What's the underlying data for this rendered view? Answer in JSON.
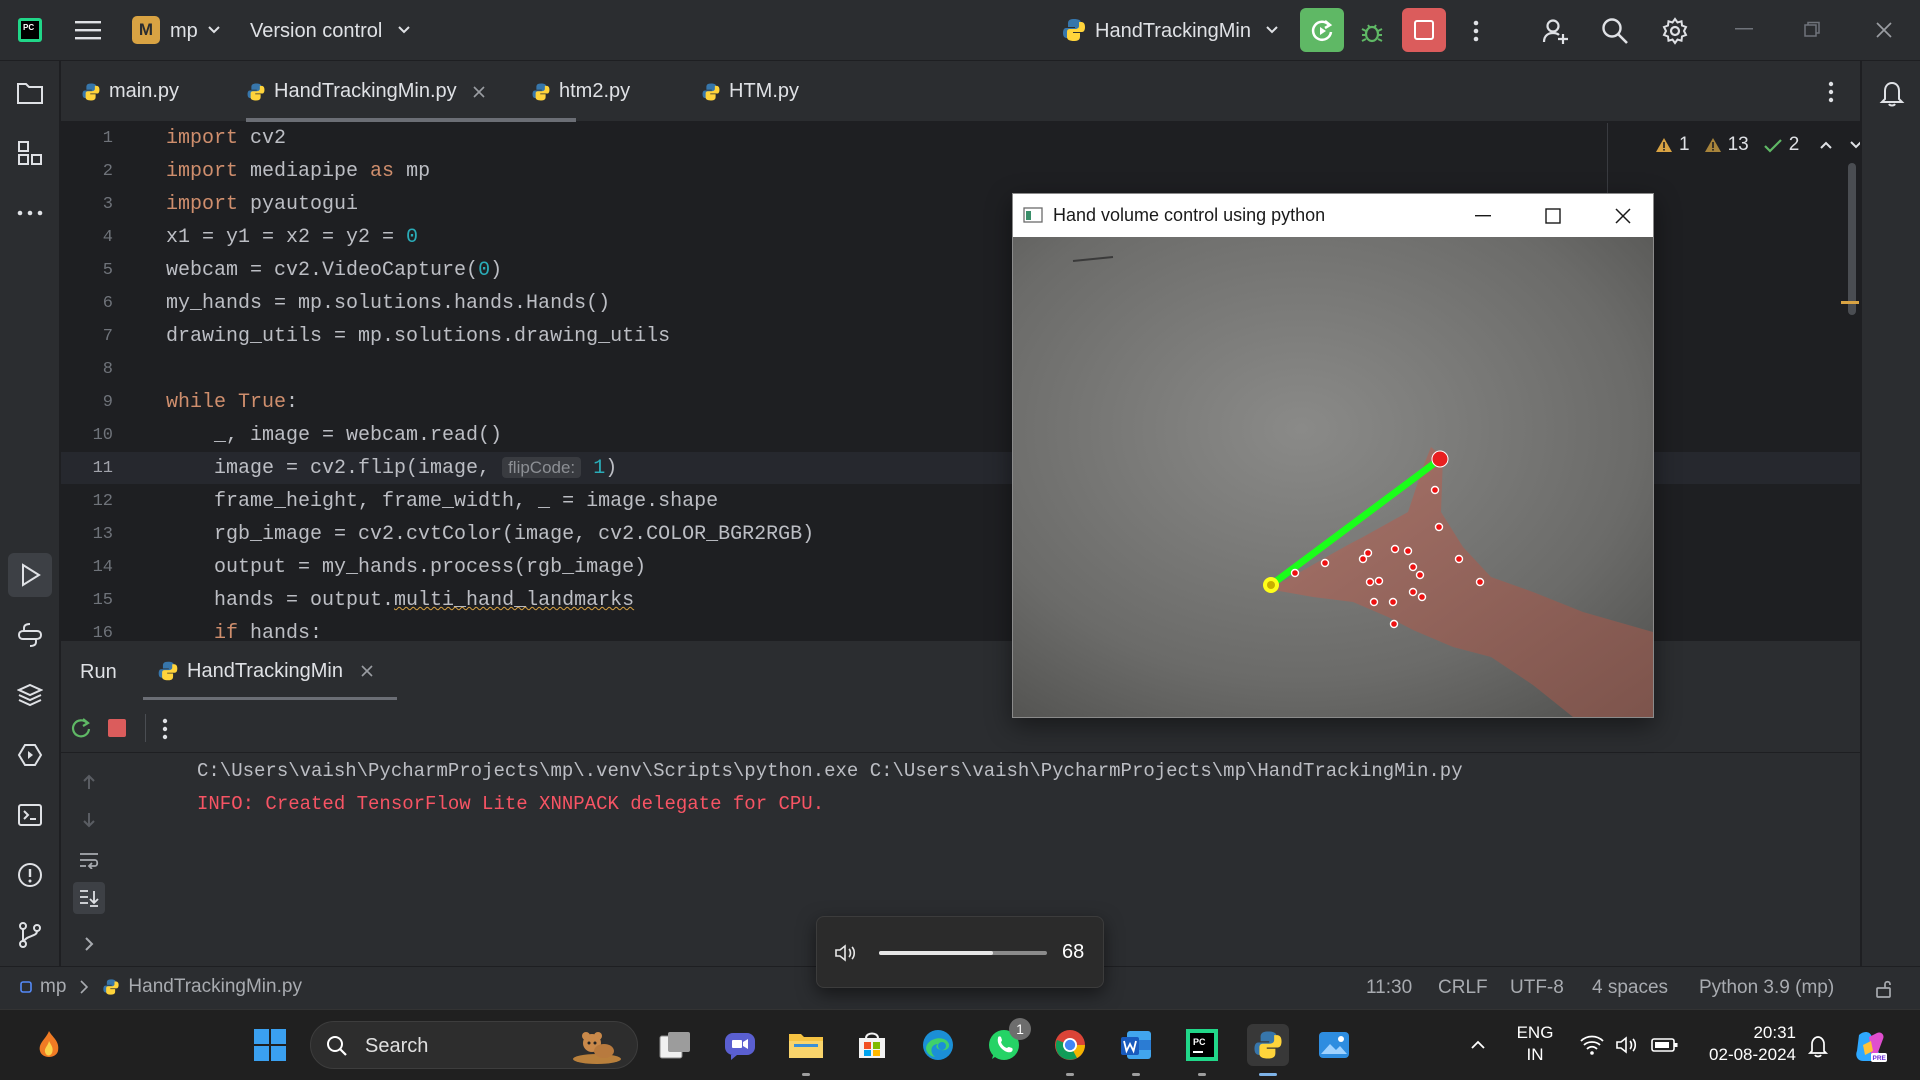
{
  "titlebar": {
    "project_badge": "M",
    "project_name": "mp",
    "vcs_label": "Version control",
    "run_config": "HandTrackingMin"
  },
  "tabs": [
    {
      "label": "main.py"
    },
    {
      "label": "HandTrackingMin.py"
    },
    {
      "label": "htm2.py"
    },
    {
      "label": "HTM.py"
    }
  ],
  "inspections": {
    "errors": "1",
    "warnings": "13",
    "ok": "2"
  },
  "code": {
    "line_numbers": [
      "1",
      "2",
      "3",
      "4",
      "5",
      "6",
      "7",
      "8",
      "9",
      "10",
      "11",
      "12",
      "13",
      "14",
      "15",
      "16"
    ],
    "l1_kw": "import",
    "l1_rest": " cv2",
    "l2_kw": "import",
    "l2_mid": " mediapipe ",
    "l2_kw2": "as",
    "l2_rest": " mp",
    "l3_kw": "import",
    "l3_rest": " pyautogui",
    "l4_rest": "x1 = y1 = x2 = y2 = ",
    "l4_num": "0",
    "l5_rest": "webcam = cv2.VideoCapture(",
    "l5_num": "0",
    "l5_end": ")",
    "l6": "my_hands = mp.solutions.hands.Hands()",
    "l7": "drawing_utils = mp.solutions.drawing_utils",
    "l9_kw": "while",
    "l9_kw2": " True",
    "l9_end": ":",
    "l10": "    _, image = webcam.read()",
    "l11_a": "    image = cv2.flip(image, ",
    "l11_hint": "flipCode:",
    "l11_num": "1",
    "l11_end": ")",
    "l12": "    frame_height, frame_width, _ = image.shape",
    "l13": "    rgb_image = cv2.cvtColor(image, cv2.COLOR_BGR2RGB)",
    "l14": "    output = my_hands.process(rgb_image)",
    "l15_a": "    hands = output.",
    "l15_b": "multi_hand_landmarks",
    "l16_kw": "    if",
    "l16_rest": " hands:"
  },
  "run": {
    "tab_run": "Run",
    "tab_config": "HandTrackingMin",
    "console_line1": "C:\\Users\\vaish\\PycharmProjects\\mp\\.venv\\Scripts\\python.exe C:\\Users\\vaish\\PycharmProjects\\mp\\HandTrackingMin.py",
    "console_line2": "INFO: Created TensorFlow Lite XNNPACK delegate for CPU."
  },
  "statusbar": {
    "breadcrumb_project": "mp",
    "breadcrumb_file": "HandTrackingMin.py",
    "position": "11:30",
    "line_sep": "CRLF",
    "encoding": "UTF-8",
    "indent": "4 spaces",
    "interpreter": "Python 3.9 (mp)"
  },
  "cv_window": {
    "title": "Hand volume control using python"
  },
  "volume": {
    "level": 68
  },
  "taskbar": {
    "search_placeholder": "Search",
    "whatsapp_badge": "1",
    "lang_line1": "ENG",
    "lang_line2": "IN",
    "time": "20:31",
    "date": "02-08-2024"
  },
  "colors": {
    "accent_run": "#5fb865",
    "accent_stop": "#db5c5c",
    "error_text": "#f75464",
    "line_green": "#1aff1a"
  }
}
